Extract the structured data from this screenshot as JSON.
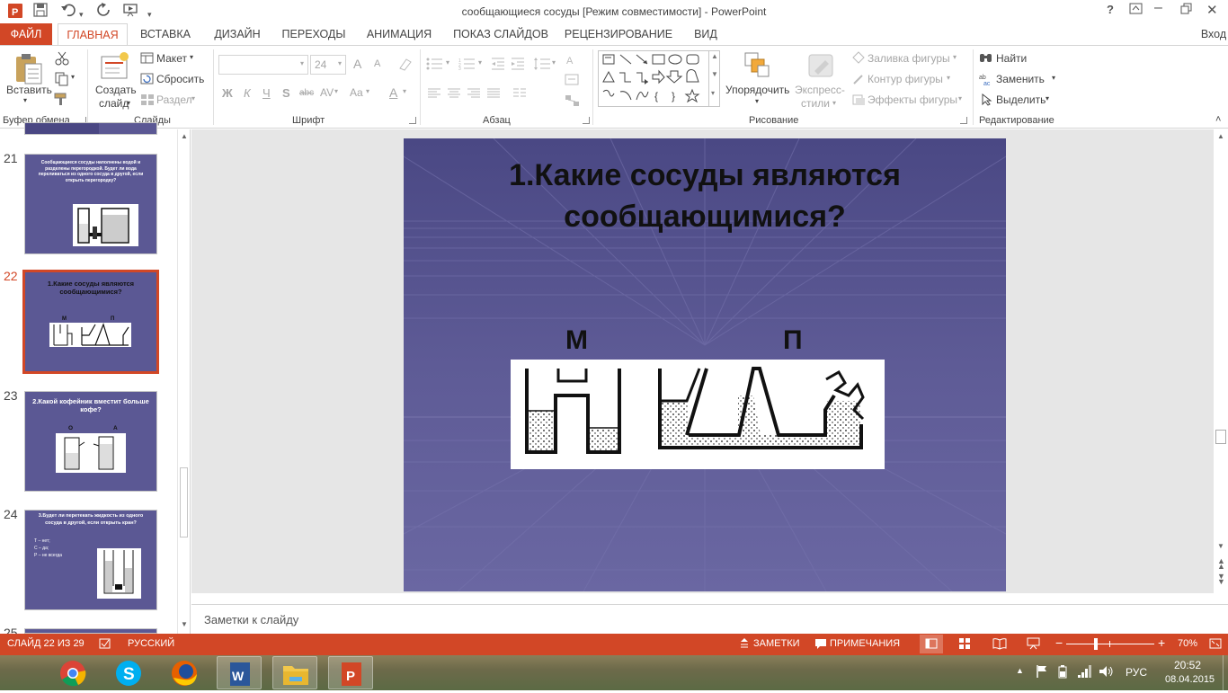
{
  "window": {
    "title": "сообщающиеся сосуды [Режим совместимости] - PowerPoint",
    "help": "?",
    "signin": "Вход"
  },
  "tabs": [
    "ФАЙЛ",
    "ГЛАВНАЯ",
    "ВСТАВКА",
    "ДИЗАЙН",
    "ПЕРЕХОДЫ",
    "АНИМАЦИЯ",
    "ПОКАЗ СЛАЙДОВ",
    "РЕЦЕНЗИРОВАНИЕ",
    "ВИД"
  ],
  "ribbon": {
    "clipboard": {
      "paste": "Вставить",
      "group": "Буфер обмена"
    },
    "slides": {
      "new_line1": "Создать",
      "new_line2": "слайд",
      "layout": "Макет",
      "reset": "Сбросить",
      "section": "Раздел",
      "group": "Слайды"
    },
    "font": {
      "size": "24",
      "bold": "Ж",
      "italic": "К",
      "underline": "Ч",
      "shadow": "S",
      "strike": "abc",
      "spacing": "AV",
      "case": "Aa",
      "color": "A",
      "grow": "A",
      "shrink": "A",
      "group": "Шрифт"
    },
    "paragraph": {
      "group": "Абзац"
    },
    "drawing": {
      "arrange": "Упорядочить",
      "quick_line1": "Экспресс-",
      "quick_line2": "стили",
      "fill": "Заливка фигуры",
      "outline": "Контур фигуры",
      "effects": "Эффекты фигуры",
      "group": "Рисование"
    },
    "editing": {
      "find": "Найти",
      "replace": "Заменить",
      "select": "Выделить",
      "group": "Редактирование"
    }
  },
  "thumbnails": [
    {
      "num": "21",
      "text": "Сообщающиеся сосуды наполнены водой и разделены перегородкой. Будет ли вода переливаться из одного сосуда в другой, если открыть перегородку?"
    },
    {
      "num": "22",
      "text": "1.Какие сосуды являются сообщающимися?",
      "labels": [
        "М",
        "П"
      ]
    },
    {
      "num": "23",
      "text": "2.Какой кофейник вместит больше кофе?",
      "labels": [
        "О",
        "А"
      ]
    },
    {
      "num": "24",
      "text": "3.Будет ли перетекать жидкость из одного сосуда в другой, если открыть кран?",
      "bullets": [
        "Т – нет;",
        "С – да;",
        "Р – не всегда"
      ]
    },
    {
      "num": "25"
    }
  ],
  "slide": {
    "title_line1": "1.Какие сосуды являются",
    "title_line2": "сообщающимися?",
    "label_left": "М",
    "label_right": "П"
  },
  "notes": {
    "placeholder": "Заметки к слайду"
  },
  "status": {
    "slide_info": "СЛАЙД 22 ИЗ 29",
    "language": "РУССКИЙ",
    "notes": "ЗАМЕТКИ",
    "comments": "ПРИМЕЧАНИЯ",
    "zoom": "70%",
    "zoom_minus": "−",
    "zoom_plus": "+"
  },
  "taskbar": {
    "lang": "РУС",
    "time": "20:52",
    "date": "08.04.2015",
    "apps": [
      "chrome-icon",
      "skype-icon",
      "firefox-icon",
      "word-icon",
      "explorer-icon",
      "powerpoint-icon"
    ]
  },
  "colors": {
    "accent": "#d24726",
    "slide_bg": "#5e5b96"
  }
}
